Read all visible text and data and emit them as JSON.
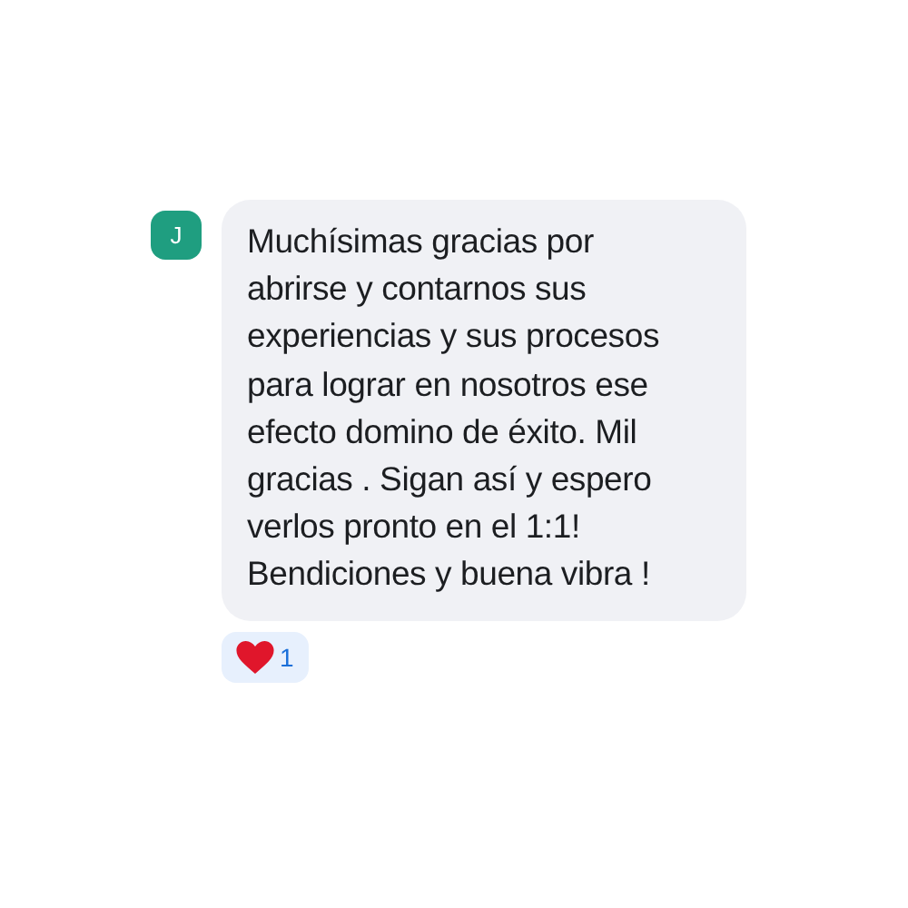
{
  "comment": {
    "avatar_initial": "J",
    "lines": [
      "Muchísimas gracias por",
      "abrirse y contarnos sus",
      "experiencias y sus procesos",
      "para lograr en nosotros ese",
      "efecto domino de éxito. Mil",
      "gracias . Sigan así y espero",
      "verlos pronto en el 1:1!",
      "Bendiciones y buena vibra !"
    ],
    "reaction": {
      "count": "1"
    }
  }
}
